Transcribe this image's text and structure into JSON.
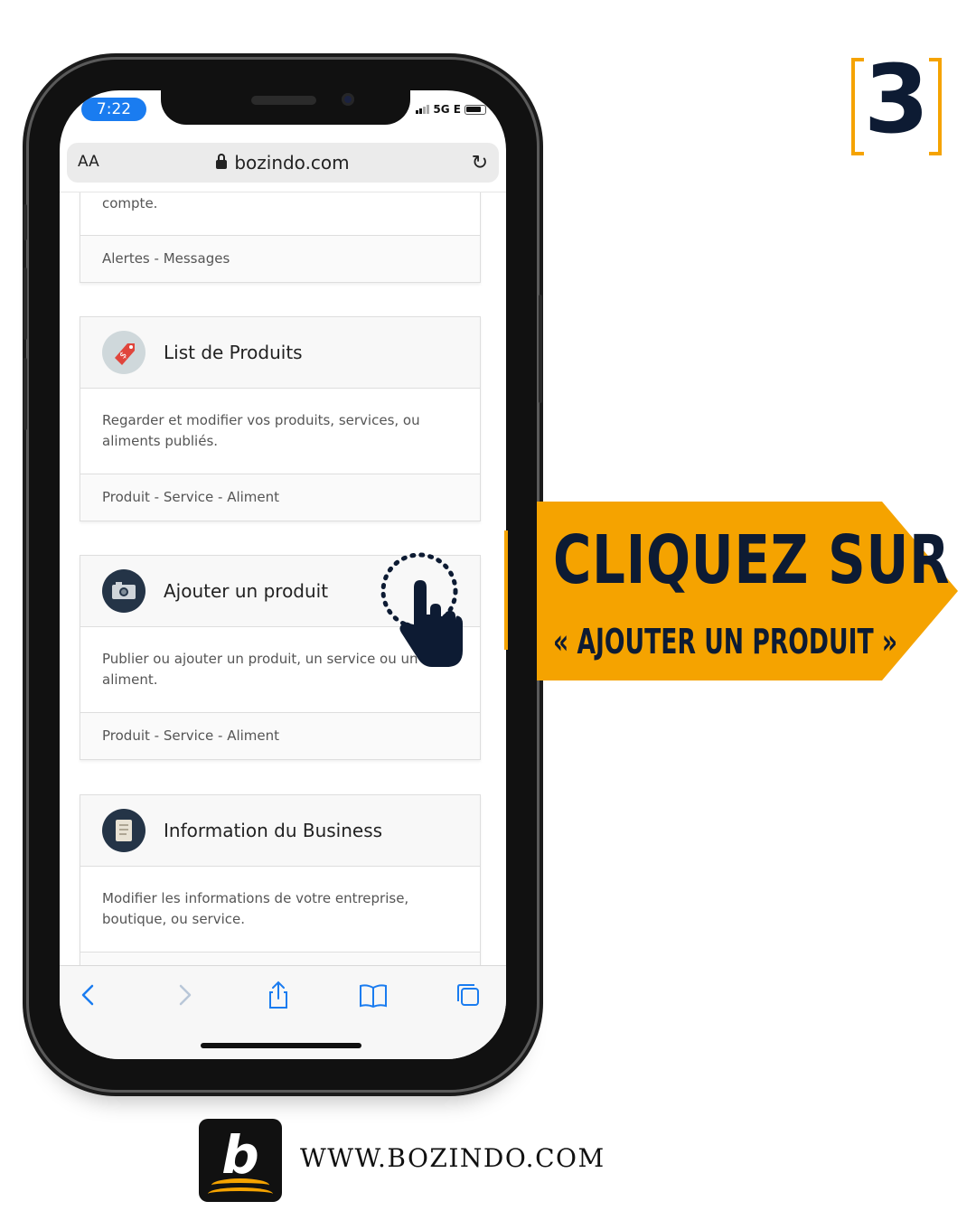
{
  "step": {
    "number": "3"
  },
  "status_bar": {
    "time": "7:22",
    "network": "5G E"
  },
  "browser": {
    "aa_label": "AA",
    "host": "bozindo.com"
  },
  "cards": [
    {
      "desc": "compte.",
      "foot": "Alertes - Messages"
    },
    {
      "title": "List de Produits",
      "desc": "Regarder et modifier vos produits, services, ou aliments publiés.",
      "foot": "Produit - Service - Aliment",
      "icon": "price-tag-icon"
    },
    {
      "title": "Ajouter un produit",
      "desc": "Publier ou ajouter un produit, un service ou un aliment.",
      "foot": "Produit - Service - Aliment",
      "icon": "camera-icon"
    },
    {
      "title": "Information du Business",
      "desc": "Modifier les informations de votre entreprise, boutique, ou service.",
      "icon": "document-icon"
    }
  ],
  "banner": {
    "line1": "CLIQUEZ SUR",
    "line2": "« AJOUTER UN PRODUIT »"
  },
  "footer": {
    "logo_letter": "b",
    "website": "WWW.BOZINDO.COM"
  },
  "colors": {
    "accent": "#f5a300",
    "navy": "#0d1b33",
    "ios_blue": "#1a7cf0"
  }
}
